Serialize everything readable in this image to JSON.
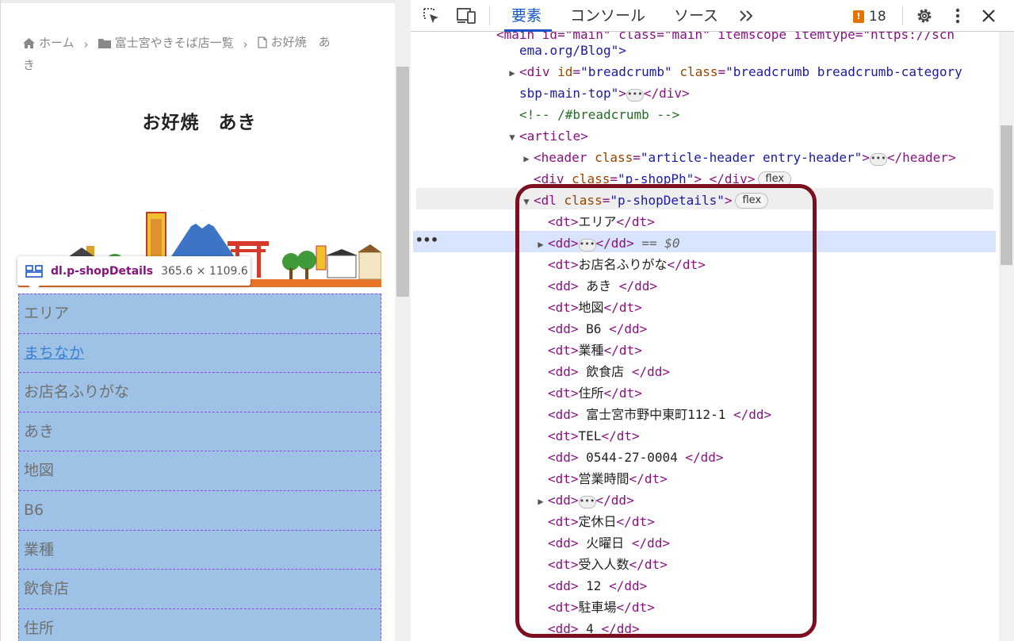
{
  "preview": {
    "breadcrumb": {
      "home": "ホーム",
      "category": "富士宮やきそば店一覧",
      "current_line1": "お好焼　あ",
      "current_line2": "き"
    },
    "page_title": "お好焼　あき",
    "tooltip": {
      "name": "dl.p-shopDetails",
      "size": "365.6 × 1109.6"
    },
    "details_rows": [
      "エリア",
      "まちなか",
      "お店名ふりがな",
      "あき",
      "地図",
      "B6",
      "業種",
      "飲食店",
      "住所"
    ],
    "details_link_index": 1
  },
  "devtools": {
    "tabs": {
      "elements": "要素",
      "console": "コンソール",
      "sources": "ソース"
    },
    "issues_count": "18",
    "tree": {
      "l0": "ema.org/Blog\">",
      "breadcrumb_id": "\"breadcrumb\"",
      "breadcrumb_class": "\"breadcrumb breadcrumb-category",
      "breadcrumb_class_cont": "sbp-main-top\"",
      "comment": "<!-- /#breadcrumb -->",
      "article": "article",
      "header_class": "\"article-header entry-header\"",
      "shopph_class": "\"p-shopPh\"",
      "dl_class": "\"p-shopDetails\"",
      "flex": "flex",
      "selected_marker": "== $0",
      "dt_area": "エリア",
      "dt_furigana": "お店名ふりがな",
      "dd_aki": " あき ",
      "dt_map": "地図",
      "dd_b6": " B6 ",
      "dt_type": "業種",
      "dd_restaurant": " 飲食店 ",
      "dt_address": "住所",
      "dd_address": " 富士宮市野中東町112-1 ",
      "dt_tel": "TEL",
      "dd_tel": " 0544-27-0004 ",
      "dt_hours": "営業時間",
      "dt_holiday": "定休日",
      "dd_holiday": " 火曜日 ",
      "dt_capacity": "受入人数",
      "dd_capacity": " 12 ",
      "dt_parking": "駐車場",
      "dd_parking": " 4 "
    }
  }
}
